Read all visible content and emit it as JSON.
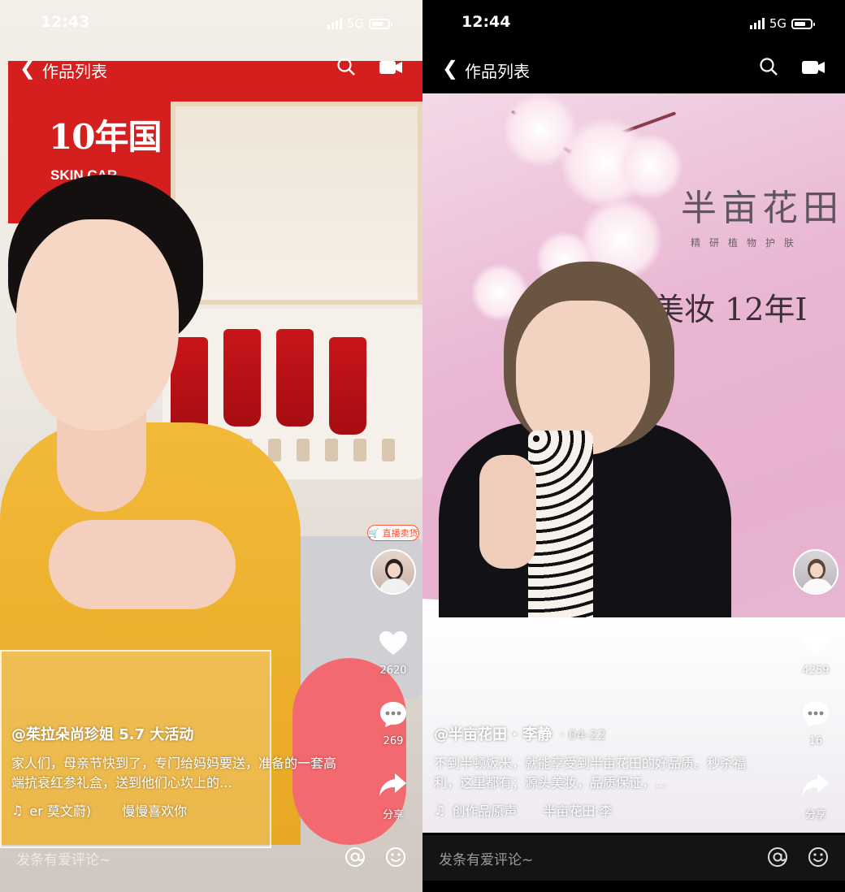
{
  "left": {
    "status": {
      "time": "12:43",
      "network": "5G"
    },
    "nav": {
      "title": "作品列表"
    },
    "scene": {
      "banner_text": "10年国",
      "banner_sub": "SKIN CAR"
    },
    "live_badge": "直播卖货",
    "likes": "2620",
    "comments": "269",
    "share_label": "分享",
    "caption": {
      "user": "@茱拉朵尚珍姐 5.7 大活动",
      "desc": "家人们，母亲节快到了，专门给妈妈要送，准备的一套高端抗衰红参礼盒，送到他们心坎上的…",
      "music": "er 莫文蔚)",
      "music_song": "慢慢喜欢你"
    },
    "comment_placeholder": "发条有爱评论~"
  },
  "right": {
    "status": {
      "time": "12:44",
      "network": "5G"
    },
    "nav": {
      "title": "作品列表"
    },
    "scene": {
      "brand": "半亩花田",
      "brand_sub": "精研植物护肤",
      "slogan": "头美妆 12年I"
    },
    "likes": "4259",
    "comments": "16",
    "share_label": "分享",
    "caption": {
      "user": "@半亩花田 · 李静",
      "date": "· 04-22",
      "desc": "不到半顿饭米，就能享受到半亩花田的好品质。秒杀福利，这里都有；源头美妆，品质保证，…",
      "music": "创作品原声",
      "music_author": "半亩花田·李"
    },
    "comment_placeholder": "发条有爱评论~"
  },
  "colors": {
    "accent_red": "#d51f1f",
    "live_orange": "#ff4a2a",
    "white": "#ffffff"
  },
  "icons": [
    "back-chevron-icon",
    "search-icon",
    "video-camera-icon",
    "heart-icon",
    "comment-bubble-icon",
    "share-arrow-icon",
    "music-note-icon",
    "at-icon",
    "emoji-icon",
    "cart-icon"
  ]
}
